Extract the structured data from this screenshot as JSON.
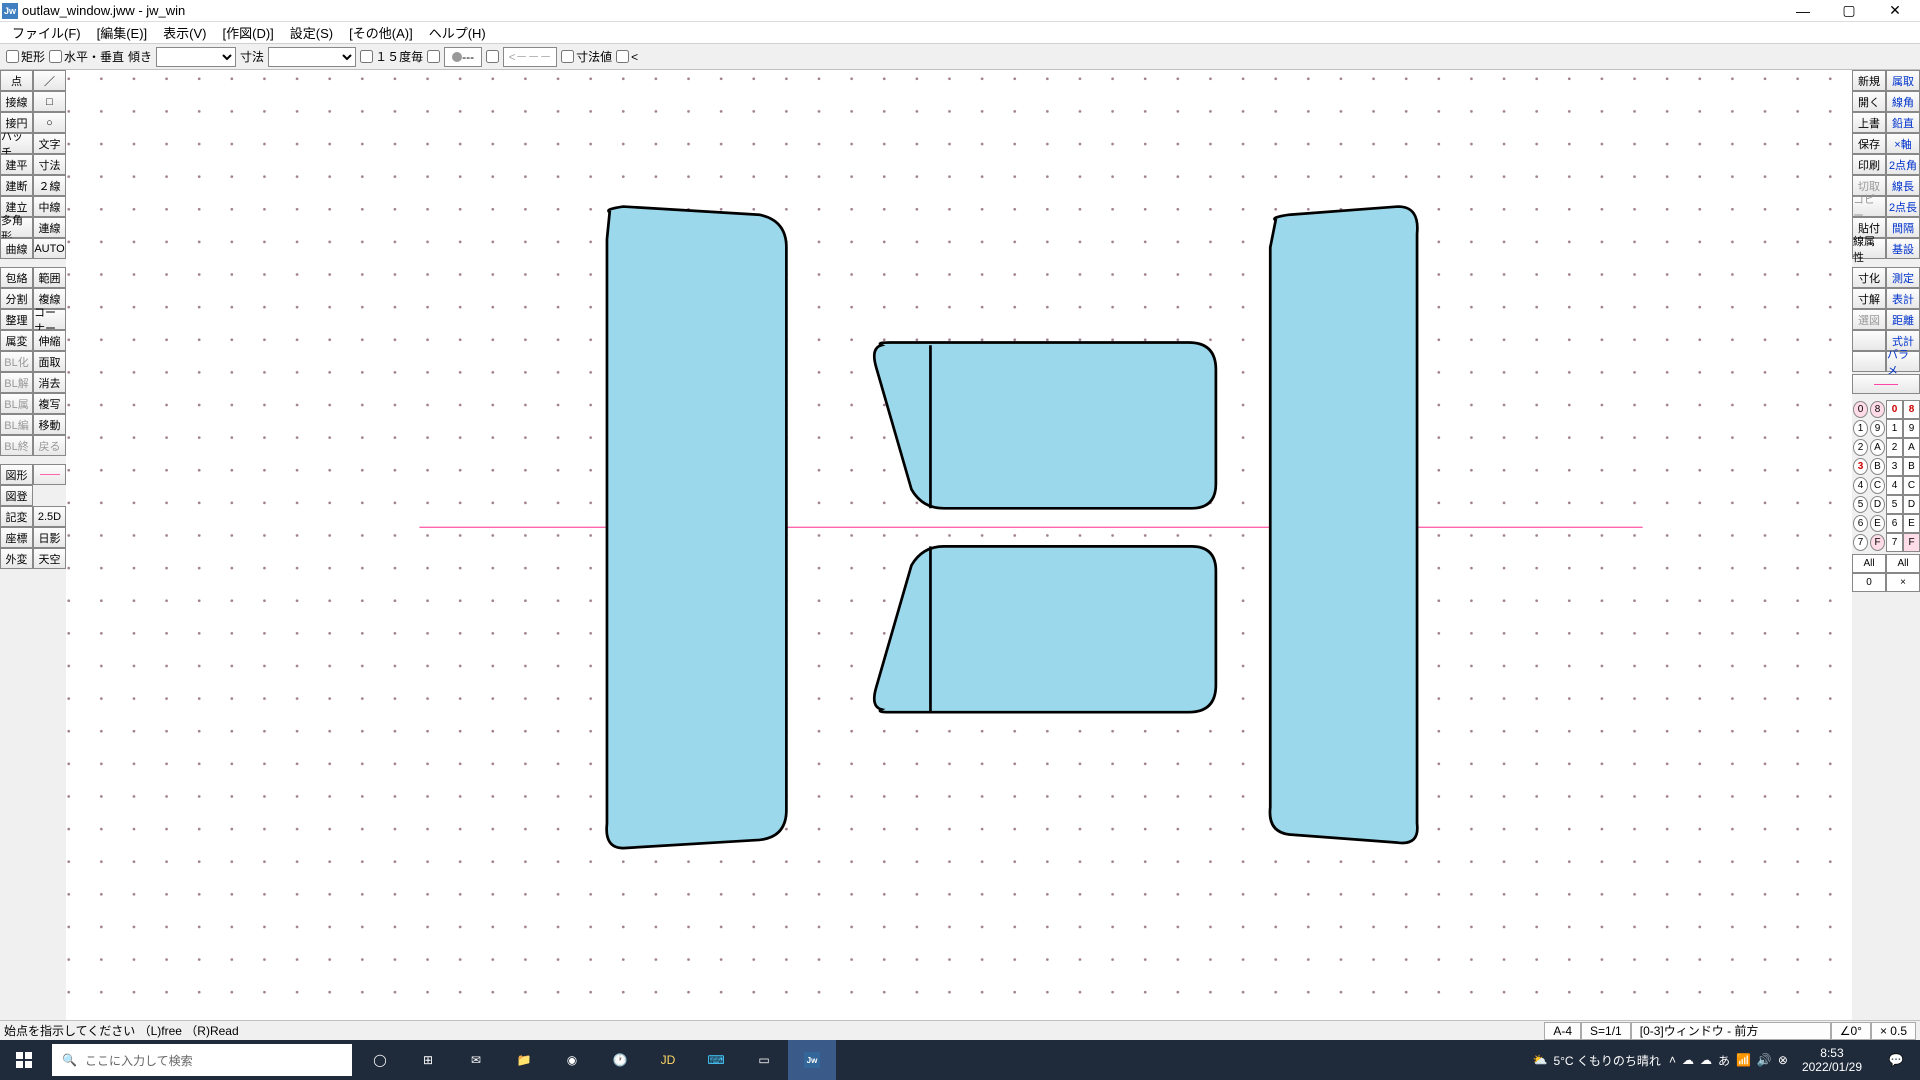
{
  "title": "outlaw_window.jww - jw_win",
  "menu": [
    "ファイル(F)",
    "[編集(E)]",
    "表示(V)",
    "[作図(D)]",
    "設定(S)",
    "[その他(A)]",
    "ヘルプ(H)"
  ],
  "toolbar": {
    "rect": "矩形",
    "hv": "水平・垂直",
    "tilt": "傾き",
    "dim": "寸法",
    "deg15": "１５度毎",
    "dimval": "寸法値",
    "lt": "<"
  },
  "leftTools": {
    "col1": [
      "点",
      "接線",
      "接円",
      "ハッチ",
      "建平",
      "建断",
      "建立",
      "多角形",
      "曲線",
      "",
      "包絡",
      "分割",
      "整理",
      "属変",
      "BL化",
      "BL解",
      "BL属",
      "BL編",
      "BL終",
      "",
      "図形",
      "図登",
      "記変",
      "座標",
      "外変"
    ],
    "col2": [
      "／",
      "□",
      "○",
      "文字",
      "寸法",
      "２線",
      "中線",
      "連線",
      "AUTO",
      "",
      "範囲",
      "複線",
      "コーナー",
      "伸縮",
      "面取",
      "消去",
      "複写",
      "移動",
      "戻る",
      "",
      "",
      "",
      "2.5D",
      "日影",
      "天空"
    ]
  },
  "rightTools": {
    "row": [
      [
        "新規",
        "属取"
      ],
      [
        "開く",
        "線角"
      ],
      [
        "上書",
        "鉛直"
      ],
      [
        "保存",
        "×軸"
      ],
      [
        "印刷",
        "2点角"
      ],
      [
        "切取",
        "線長"
      ],
      [
        "コピー",
        "2点長"
      ],
      [
        "貼付",
        "間隔"
      ],
      [
        "線属性",
        "基設"
      ],
      [
        "寸化",
        "測定"
      ],
      [
        "寸解",
        "表計"
      ],
      [
        "選図",
        "距離"
      ],
      [
        "",
        "式計"
      ],
      [
        "",
        "パラメ"
      ]
    ]
  },
  "layers": {
    "grid": [
      [
        "0",
        "8",
        "0",
        "8"
      ],
      [
        "1",
        "9",
        "1",
        "9"
      ],
      [
        "2",
        "A",
        "2",
        "A"
      ],
      [
        "3",
        "B",
        "3",
        "B"
      ],
      [
        "4",
        "C",
        "4",
        "C"
      ],
      [
        "5",
        "D",
        "5",
        "D"
      ],
      [
        "6",
        "E",
        "6",
        "E"
      ],
      [
        "7",
        "F",
        "7",
        "F"
      ]
    ],
    "all": "All",
    "zero": "0",
    "x": "×"
  },
  "status": {
    "msg": "始点を指示してください （L)free （R)Read",
    "paper": "A-4",
    "scale": "S=1/1",
    "layer": "[0-3]ウィンドウ - 前方",
    "angle": "∠0°",
    "zoom": "× 0.5"
  },
  "taskbar": {
    "search_placeholder": "ここに入力して検索",
    "weather": "5°C くもりのち晴れ",
    "time": "8:53",
    "date": "2022/01/29"
  }
}
